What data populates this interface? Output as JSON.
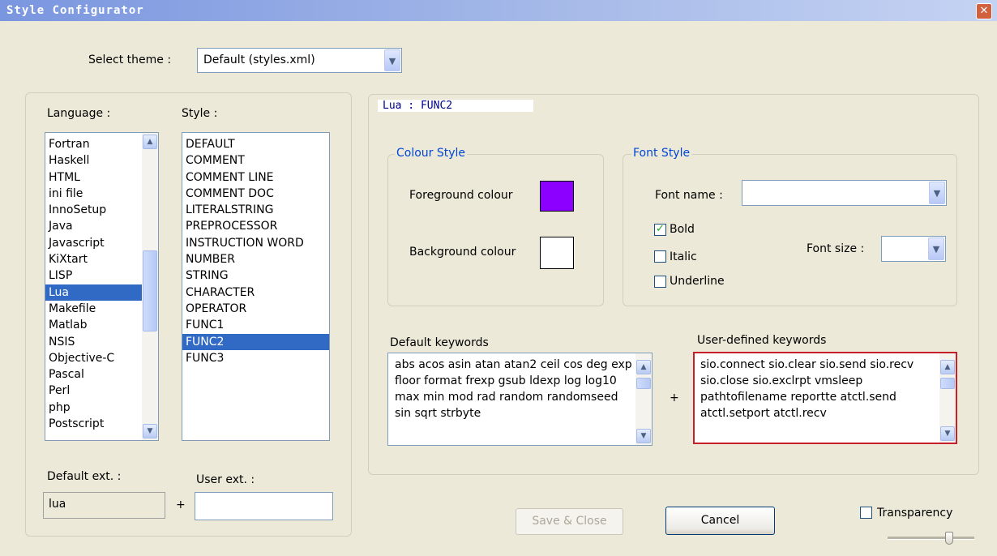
{
  "window": {
    "title": "Style Configurator"
  },
  "theme": {
    "label": "Select theme :",
    "value": "Default (styles.xml)"
  },
  "language": {
    "label": "Language :",
    "items": [
      "Fortran",
      "Haskell",
      "HTML",
      "ini file",
      "InnoSetup",
      "Java",
      "Javascript",
      "KiXtart",
      "LISP",
      "Lua",
      "Makefile",
      "Matlab",
      "NSIS",
      "Objective-C",
      "Pascal",
      "Perl",
      "php",
      "Postscript"
    ],
    "selected": "Lua"
  },
  "style": {
    "label": "Style :",
    "items": [
      "DEFAULT",
      "COMMENT",
      "COMMENT LINE",
      "COMMENT DOC",
      "LITERALSTRING",
      "PREPROCESSOR",
      "INSTRUCTION WORD",
      "NUMBER",
      "STRING",
      "CHARACTER",
      "OPERATOR",
      "FUNC1",
      "FUNC2",
      "FUNC3"
    ],
    "selected": "FUNC2"
  },
  "ext": {
    "default_label": "Default ext. :",
    "default_value": "lua",
    "plus": "+",
    "user_label": "User ext. :",
    "user_value": ""
  },
  "panel_title": "Lua : FUNC2",
  "colour_style": {
    "legend": "Colour Style",
    "fg_label": "Foreground colour",
    "fg_color": "#8b00ff",
    "bg_label": "Background colour",
    "bg_color": "#ffffff"
  },
  "font_style": {
    "legend": "Font Style",
    "name_label": "Font name :",
    "name_value": "",
    "bold_label": "Bold",
    "bold_checked": true,
    "italic_label": "Italic",
    "italic_checked": false,
    "underline_label": "Underline",
    "underline_checked": false,
    "size_label": "Font size :",
    "size_value": ""
  },
  "keywords": {
    "default_label": "Default keywords",
    "default_text": "abs acos asin atan atan2 ceil cos deg exp floor format frexp gsub ldexp log log10 max min mod rad random randomseed sin sqrt strbyte",
    "plus": "+",
    "user_label": "User-defined keywords",
    "user_text": "sio.connect sio.clear sio.send sio.recv sio.close sio.exclrpt vmsleep pathtofilename reportte atctl.send atctl.setport atctl.recv"
  },
  "buttons": {
    "save_close": "Save & Close",
    "cancel": "Cancel"
  },
  "transparency": {
    "label": "Transparency",
    "checked": false
  },
  "icons": {
    "close": "close-icon",
    "arrow_down": "chevron-down-icon",
    "arrow_up": "chevron-up-icon",
    "check": "check-icon"
  }
}
